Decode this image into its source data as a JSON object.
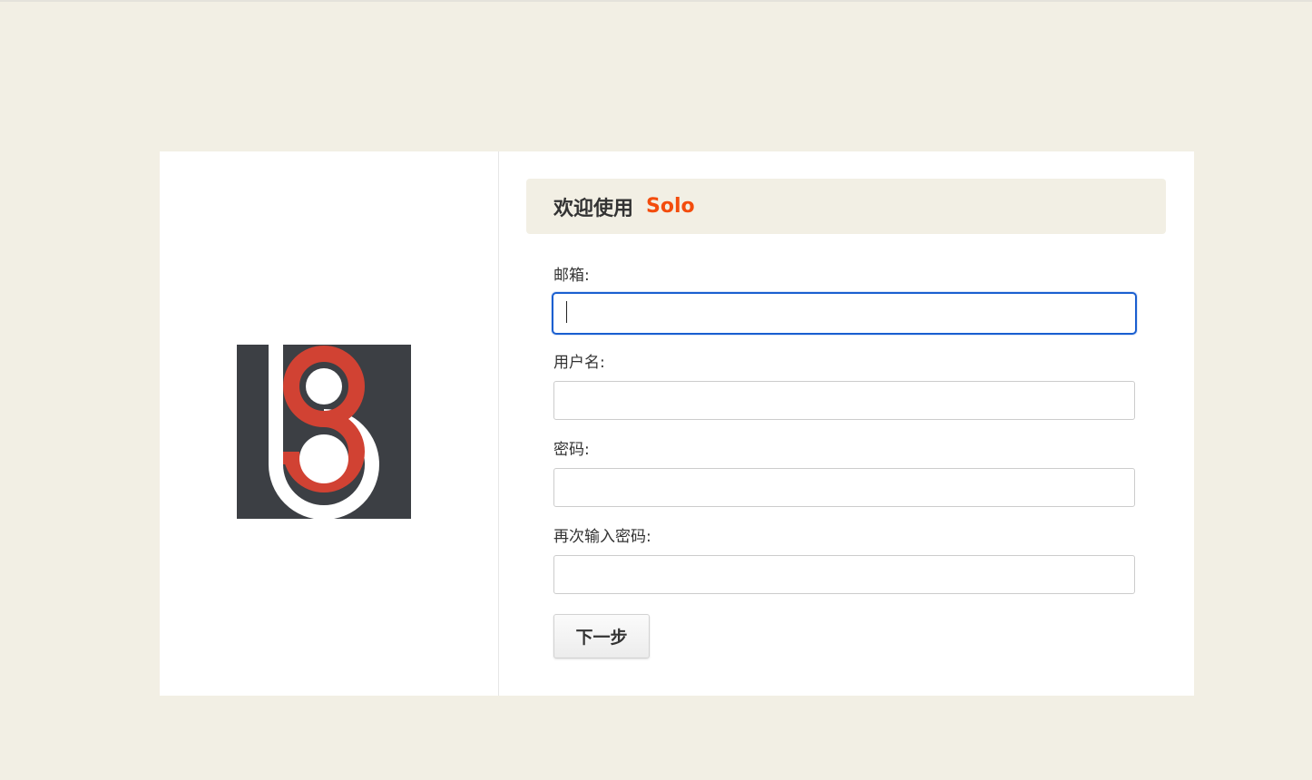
{
  "header": {
    "welcome_text": "欢迎使用",
    "brand": "Solo"
  },
  "colors": {
    "background": "#f2efe4",
    "brand_accent": "#f34c0d",
    "focus_ring": "#1a5fd0",
    "logo_dark": "#3c3f44",
    "logo_red": "#d14233"
  },
  "form": {
    "email": {
      "label": "邮箱:",
      "value": ""
    },
    "username": {
      "label": "用户名:",
      "value": ""
    },
    "password": {
      "label": "密码:",
      "value": ""
    },
    "confirm_password": {
      "label": "再次输入密码:",
      "value": ""
    },
    "next_label": "下一步"
  },
  "logo": {
    "icon": "solo-logo-icon"
  }
}
